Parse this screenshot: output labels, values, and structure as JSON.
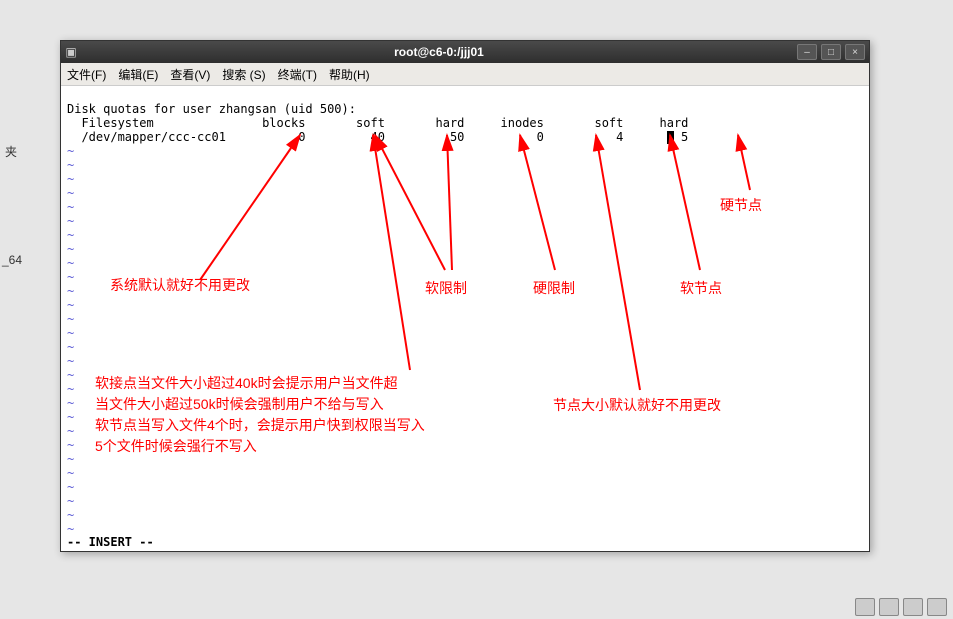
{
  "desktop": {
    "label_left1": "夹",
    "label_left2": "_64"
  },
  "window": {
    "title": "root@c6-0:/jjj01",
    "menu": {
      "file": "文件(F)",
      "edit": "编辑(E)",
      "view": "查看(V)",
      "search": "搜索 (S)",
      "terminal": "终端(T)",
      "help": "帮助(H)"
    }
  },
  "terminal": {
    "line1": "Disk quotas for user zhangsan (uid 500):",
    "headers": {
      "c1": "Filesystem",
      "c2": "blocks",
      "c3": "soft",
      "c4": "hard",
      "c5": "inodes",
      "c6": "soft",
      "c7": "hard"
    },
    "data": {
      "fs": "/dev/mapper/ccc-cc01",
      "blocks": "0",
      "soft1": "40",
      "hard1": "50",
      "inodes": "0",
      "soft2": "4",
      "hard2": "5"
    },
    "status": "-- INSERT --"
  },
  "annotations": {
    "a1": "系统默认就好不用更改",
    "a2": "软限制",
    "a3": "硬限制",
    "a4": "软节点",
    "a5": "硬节点",
    "a6": "节点大小默认就好不用更改",
    "p1": "软接点当文件大小超过40k时会提示用户当文件超",
    "p2": "当文件大小超过50k时候会强制用户不给与写入",
    "p3": "软节点当写入文件4个时，会提示用户快到权限当写入",
    "p4": "5个文件时候会强行不写入"
  }
}
